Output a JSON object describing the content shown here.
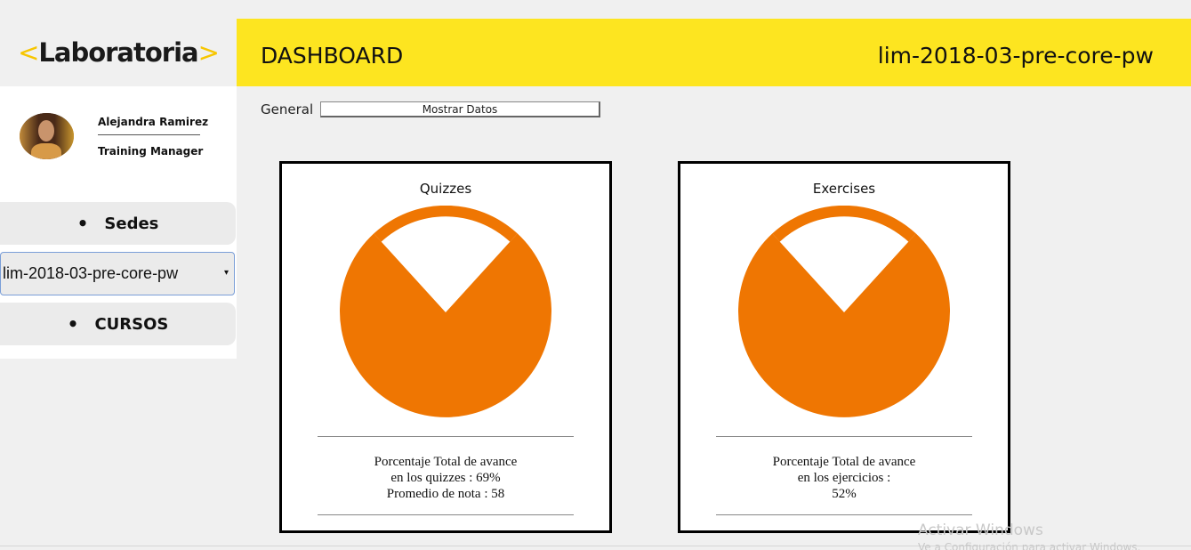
{
  "logo": {
    "text": "Laboratoria",
    "left_chevron": "<",
    "right_chevron": ">"
  },
  "profile": {
    "name": "Alejandra Ramirez",
    "role": "Training Manager"
  },
  "sidebar": {
    "sedes_label": "Sedes",
    "cohort_select": {
      "selected": "lim-2018-03-pre-core-pw"
    },
    "cursos_label": "CURSOS",
    "bullet": "•",
    "arrow": "▾"
  },
  "header": {
    "title": "DASHBOARD",
    "cohort": "lim-2018-03-pre-core-pw"
  },
  "general": {
    "label": "General",
    "show_button": "Mostrar Datos"
  },
  "colors": {
    "accent": "#fde520",
    "pie": "#ef7602",
    "chevron": "#f7c600"
  },
  "cards": {
    "quizzes": {
      "title": "Quizzes",
      "line1": "Porcentaje Total de avance",
      "line2": "en los quizzes : 69%",
      "line3": "Promedio de nota : 58"
    },
    "exercises": {
      "title": "Exercises",
      "line1": "Porcentaje Total de avance",
      "line2": "en los ejercicios :",
      "line3": "52%"
    }
  },
  "watermark": {
    "title": "Activar Windows",
    "subtitle": "Ve a Configuración para activar Windows."
  }
}
